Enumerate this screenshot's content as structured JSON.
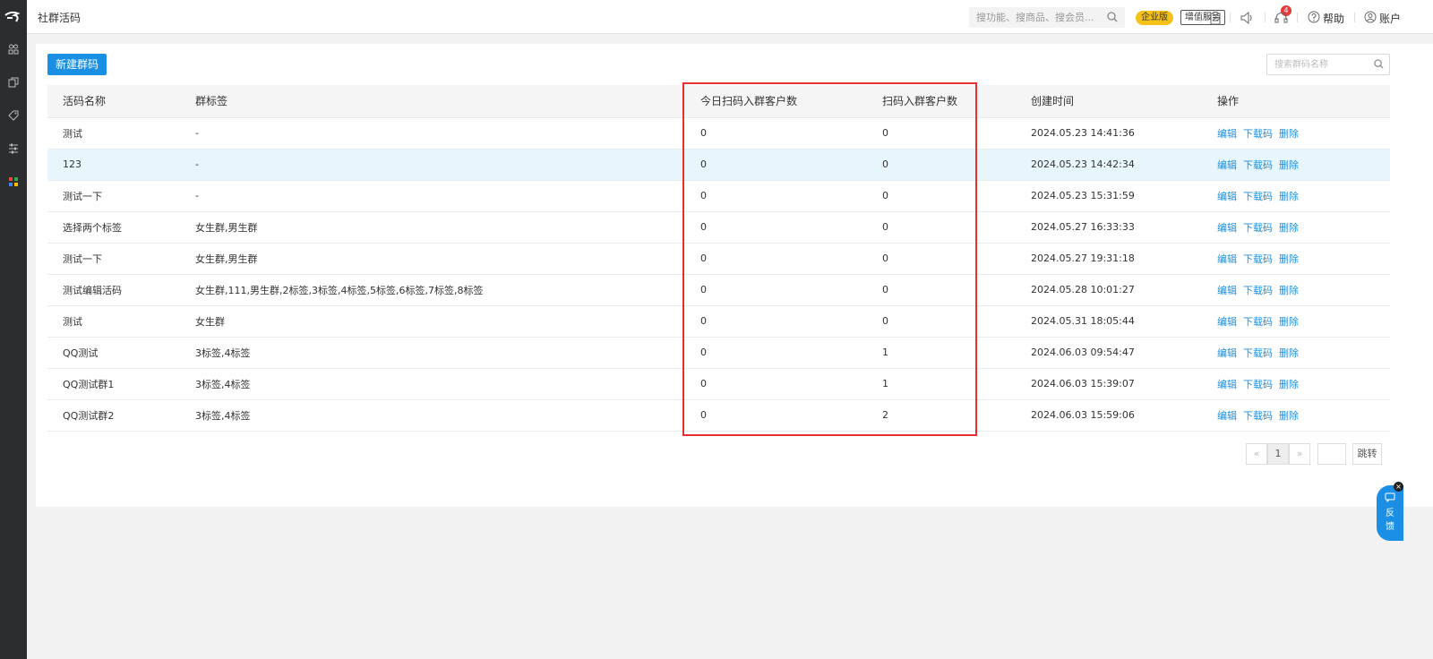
{
  "header": {
    "title": "社群活码",
    "search_placeholder": "搜功能、搜商品、搜会员...",
    "enterprise_badge": "企业版",
    "vas_label": "增值服务",
    "notification_count": "4",
    "help_label": "帮助",
    "account_label": "账户"
  },
  "toolbar": {
    "new_button": "新建群码",
    "search_placeholder": "搜索群码名称"
  },
  "table": {
    "columns": [
      "活码名称",
      "群标签",
      "今日扫码入群客户数",
      "扫码入群客户数",
      "创建时间",
      "操作"
    ],
    "rows": [
      {
        "name": "测试",
        "tags": "-",
        "today": "0",
        "total": "0",
        "created": "2024.05.23 14:41:36"
      },
      {
        "name": "123",
        "tags": "-",
        "today": "0",
        "total": "0",
        "created": "2024.05.23 14:42:34"
      },
      {
        "name": "测试一下",
        "tags": "-",
        "today": "0",
        "total": "0",
        "created": "2024.05.23 15:31:59"
      },
      {
        "name": "选择两个标签",
        "tags": "女生群,男生群",
        "today": "0",
        "total": "0",
        "created": "2024.05.27 16:33:33"
      },
      {
        "name": "测试一下",
        "tags": "女生群,男生群",
        "today": "0",
        "total": "0",
        "created": "2024.05.27 19:31:18"
      },
      {
        "name": "测试编辑活码",
        "tags": "女生群,111,男生群,2标签,3标签,4标签,5标签,6标签,7标签,8标签",
        "today": "0",
        "total": "0",
        "created": "2024.05.28 10:01:27"
      },
      {
        "name": "测试",
        "tags": "女生群",
        "today": "0",
        "total": "0",
        "created": "2024.05.31 18:05:44"
      },
      {
        "name": "QQ测试",
        "tags": "3标签,4标签",
        "today": "0",
        "total": "1",
        "created": "2024.06.03 09:54:47"
      },
      {
        "name": "QQ测试群1",
        "tags": "3标签,4标签",
        "today": "0",
        "total": "1",
        "created": "2024.06.03 15:39:07"
      },
      {
        "name": "QQ测试群2",
        "tags": "3标签,4标签",
        "today": "0",
        "total": "2",
        "created": "2024.06.03 15:59:06"
      }
    ],
    "actions": {
      "edit": "编辑",
      "download": "下载码",
      "delete": "删除"
    }
  },
  "pagination": {
    "prev": "«",
    "current": "1",
    "next": "»",
    "jump_label": "跳转"
  },
  "feedback": {
    "line1": "反",
    "line2": "馈",
    "close": "×"
  },
  "colors": {
    "accent": "#1a8fe3",
    "highlight_box": "#e62f2f",
    "row_highlight": "#e7f6fd"
  }
}
